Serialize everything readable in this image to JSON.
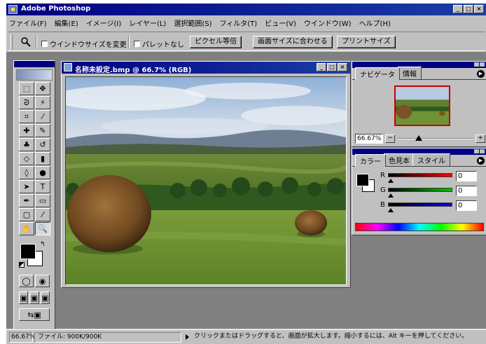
{
  "app": {
    "title": "Adobe Photoshop",
    "window_buttons": [
      "_",
      "□",
      "×"
    ]
  },
  "menu": [
    "ファイル(F)",
    "編集(E)",
    "イメージ(I)",
    "レイヤー(L)",
    "選択範囲(S)",
    "フィルタ(T)",
    "ビュー(V)",
    "ウインドウ(W)",
    "ヘルプ(H)"
  ],
  "options_bar": {
    "tool_icon": "zoom-icon",
    "resize_window_label": "ウインドウサイズを変更",
    "no_palettes_label": "パレットなし",
    "actual_pixels_label": "ピクセル等倍",
    "fit_on_screen_label": "画面サイズに合わせる",
    "print_size_label": "プリントサイズ"
  },
  "toolbox": {
    "tools": [
      {
        "name": "marquee-tool",
        "icon": "⬚"
      },
      {
        "name": "move-tool",
        "icon": "✥"
      },
      {
        "name": "lasso-tool",
        "icon": "ᘐ"
      },
      {
        "name": "magic-wand-tool",
        "icon": "⚡"
      },
      {
        "name": "crop-tool",
        "icon": "⌗"
      },
      {
        "name": "slice-tool",
        "icon": "⁄"
      },
      {
        "name": "healing-brush-tool",
        "icon": "✚"
      },
      {
        "name": "brush-tool",
        "icon": "✎"
      },
      {
        "name": "stamp-tool",
        "icon": "♣"
      },
      {
        "name": "history-brush-tool",
        "icon": "↺"
      },
      {
        "name": "eraser-tool",
        "icon": "◇"
      },
      {
        "name": "gradient-tool",
        "icon": "▮"
      },
      {
        "name": "blur-tool",
        "icon": "◊"
      },
      {
        "name": "dodge-tool",
        "icon": "●"
      },
      {
        "name": "path-selection-tool",
        "icon": "➤"
      },
      {
        "name": "type-tool",
        "icon": "T"
      },
      {
        "name": "pen-tool",
        "icon": "✒"
      },
      {
        "name": "shape-tool",
        "icon": "▭"
      },
      {
        "name": "notes-tool",
        "icon": "▢"
      },
      {
        "name": "eyedropper-tool",
        "icon": "⁄"
      },
      {
        "name": "hand-tool",
        "icon": "✋"
      },
      {
        "name": "zoom-tool",
        "icon": "🔍"
      }
    ]
  },
  "document": {
    "title": "名称未設定.bmp @ 66.7% (RGB)"
  },
  "navigator": {
    "tabs": [
      "ナビゲータ",
      "情報"
    ],
    "zoom": "66.67%"
  },
  "color_panel": {
    "tabs": [
      "カラー",
      "色見本",
      "スタイル"
    ],
    "channels": [
      {
        "label": "R",
        "value": "0",
        "color": "#ff0000"
      },
      {
        "label": "G",
        "value": "0",
        "color": "#00c000"
      },
      {
        "label": "B",
        "value": "0",
        "color": "#0000ff"
      }
    ]
  },
  "status": {
    "zoom": "66.67%",
    "doc_info": "ファイル: 900K/900K",
    "hint": "クリックまたはドラッグすると、画面が拡大します。縮小するには、Alt キーを押してください。"
  }
}
